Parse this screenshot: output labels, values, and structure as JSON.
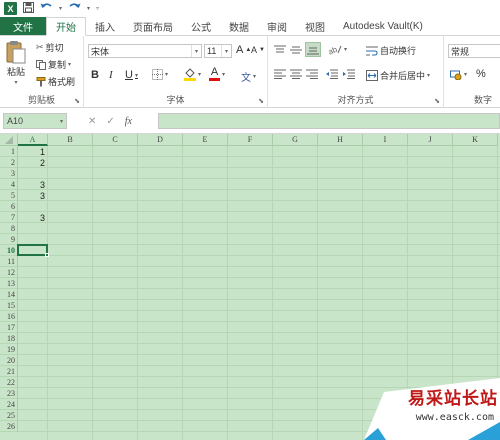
{
  "quick_access": {
    "logo_text": "X",
    "icons": [
      "save-icon",
      "undo-icon",
      "redo-icon",
      "customize-icon"
    ]
  },
  "tabs": [
    {
      "label": "文件",
      "kind": "file"
    },
    {
      "label": "开始",
      "kind": "active"
    },
    {
      "label": "插入"
    },
    {
      "label": "页面布局"
    },
    {
      "label": "公式"
    },
    {
      "label": "数据"
    },
    {
      "label": "审阅"
    },
    {
      "label": "视图"
    },
    {
      "label": "Autodesk Vault(K)"
    }
  ],
  "clipboard": {
    "paste_label": "粘贴",
    "cut_label": "剪切",
    "copy_label": "复制",
    "format_painter_label": "格式刷",
    "group_label": "剪贴板"
  },
  "font": {
    "name": "宋体",
    "size": "11",
    "grow": "A",
    "shrink": "A",
    "bold": "B",
    "italic": "I",
    "underline": "U",
    "font_color_letter": "A",
    "phonetic": "文",
    "group_label": "字体"
  },
  "alignment": {
    "wrap_text_label": "自动换行",
    "merge_label": "合并后居中",
    "group_label": "对齐方式"
  },
  "number": {
    "format": "常规",
    "percent": "%",
    "group_label": "数字"
  },
  "formula_bar": {
    "name_box": "A10",
    "fx": "fx",
    "cancel": "✕",
    "enter": "✓",
    "value": ""
  },
  "sheet": {
    "columns": [
      "A",
      "B",
      "C",
      "D",
      "E",
      "F",
      "G",
      "H",
      "I",
      "J",
      "K"
    ],
    "selected_column": "A",
    "rows": [
      "1",
      "2",
      "3",
      "4",
      "5",
      "6",
      "7",
      "8",
      "9",
      "10",
      "11",
      "12",
      "13",
      "14",
      "15",
      "16",
      "17",
      "18",
      "19",
      "20",
      "21",
      "22",
      "23",
      "24",
      "25",
      "26"
    ],
    "selected_row": "10",
    "cells": [
      {
        "ref": "A1",
        "value": "1"
      },
      {
        "ref": "A2",
        "value": "2"
      },
      {
        "ref": "A4",
        "value": "3"
      },
      {
        "ref": "A5",
        "value": "3"
      },
      {
        "ref": "A7",
        "value": "3"
      }
    ],
    "active_cell": "A10",
    "colors": {
      "background": "#c9e5c9",
      "accent": "#217346"
    }
  },
  "watermark": {
    "text": "易采站长站",
    "url": "www.easck.com"
  }
}
